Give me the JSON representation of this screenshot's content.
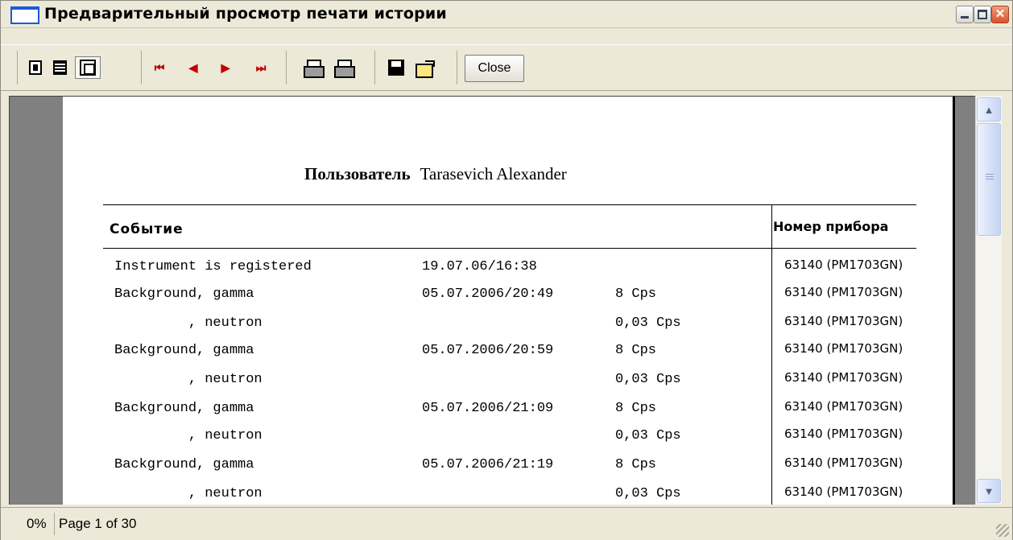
{
  "window": {
    "title": "Предварительный просмотр печати истории"
  },
  "toolbar": {
    "close_label": "Close",
    "buttons": [
      "single-page",
      "page-width",
      "fit-page",
      "first-page",
      "previous-page",
      "next-page",
      "last-page",
      "print-setup",
      "print",
      "save",
      "open"
    ]
  },
  "report": {
    "user_label": "Пользователь",
    "user_name": "Tarasevich Alexander",
    "columns": {
      "event": "Событие",
      "device": "Номер прибора"
    },
    "rows": [
      {
        "event": "Instrument is registered",
        "date": "19.07.06/16:38",
        "value": "",
        "device": "63140 (PM1703GN)"
      },
      {
        "event": "Background, gamma",
        "date": "05.07.2006/20:49",
        "value": "8 Cps",
        "device": "63140 (PM1703GN)"
      },
      {
        "event": "         , neutron",
        "date": "",
        "value": "0,03 Cps",
        "device": "63140 (PM1703GN)"
      },
      {
        "event": "Background, gamma",
        "date": "05.07.2006/20:59",
        "value": "8 Cps",
        "device": "63140 (PM1703GN)"
      },
      {
        "event": "         , neutron",
        "date": "",
        "value": "0,03 Cps",
        "device": "63140 (PM1703GN)"
      },
      {
        "event": "Background, gamma",
        "date": "05.07.2006/21:09",
        "value": "8 Cps",
        "device": "63140 (PM1703GN)"
      },
      {
        "event": "         , neutron",
        "date": "",
        "value": "0,03 Cps",
        "device": "63140 (PM1703GN)"
      },
      {
        "event": "Background, gamma",
        "date": "05.07.2006/21:19",
        "value": "8 Cps",
        "device": "63140 (PM1703GN)"
      },
      {
        "event": "         , neutron",
        "date": "",
        "value": "0,03 Cps",
        "device": "63140 (PM1703GN)"
      }
    ]
  },
  "status": {
    "zoom": "0%",
    "page": "Page 1 of 30"
  }
}
